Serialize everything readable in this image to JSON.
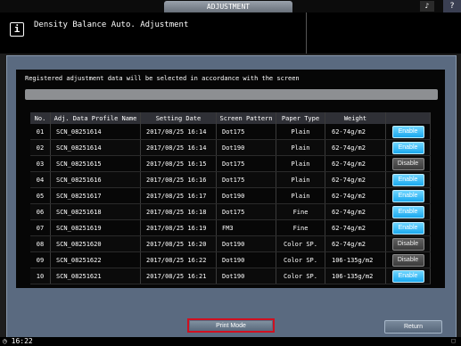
{
  "header": {
    "tab_label": "ADJUSTMENT",
    "sound_icon": "speaker-icon",
    "help_label": "?"
  },
  "message": {
    "icon_label": "i",
    "title": "Density Balance Auto. Adjustment"
  },
  "main": {
    "instruction": "Registered adjustment data will be selected in accordance with the screen",
    "columns": [
      "No.",
      "Adj. Data Profile Name",
      "Setting Date",
      "Screen Pattern",
      "Paper Type",
      "Weight",
      ""
    ],
    "rows": [
      {
        "no": "01",
        "name": "SCN_08251614",
        "date": "2017/08/25 16:14",
        "pattern": "Dot175",
        "paper": "Plain",
        "weight": "62-74g/m2",
        "status": "Enable",
        "state": "enable"
      },
      {
        "no": "02",
        "name": "SCN_08251614",
        "date": "2017/08/25 16:14",
        "pattern": "Dot190",
        "paper": "Plain",
        "weight": "62-74g/m2",
        "status": "Enable",
        "state": "enable"
      },
      {
        "no": "03",
        "name": "SCN_08251615",
        "date": "2017/08/25 16:15",
        "pattern": "Dot175",
        "paper": "Plain",
        "weight": "62-74g/m2",
        "status": "Disable",
        "state": "disable"
      },
      {
        "no": "04",
        "name": "SCN_08251616",
        "date": "2017/08/25 16:16",
        "pattern": "Dot175",
        "paper": "Plain",
        "weight": "62-74g/m2",
        "status": "Enable",
        "state": "enable"
      },
      {
        "no": "05",
        "name": "SCN_08251617",
        "date": "2017/08/25 16:17",
        "pattern": "Dot190",
        "paper": "Plain",
        "weight": "62-74g/m2",
        "status": "Enable",
        "state": "enable"
      },
      {
        "no": "06",
        "name": "SCN_08251618",
        "date": "2017/08/25 16:18",
        "pattern": "Dot175",
        "paper": "Fine",
        "weight": "62-74g/m2",
        "status": "Enable",
        "state": "enable"
      },
      {
        "no": "07",
        "name": "SCN_08251619",
        "date": "2017/08/25 16:19",
        "pattern": "FM3",
        "paper": "Fine",
        "weight": "62-74g/m2",
        "status": "Enable",
        "state": "enable"
      },
      {
        "no": "08",
        "name": "SCN_08251620",
        "date": "2017/08/25 16:20",
        "pattern": "Dot190",
        "paper": "Color SP.",
        "weight": "62-74g/m2",
        "status": "Disable",
        "state": "disable"
      },
      {
        "no": "09",
        "name": "SCN_08251622",
        "date": "2017/08/25 16:22",
        "pattern": "Dot190",
        "paper": "Color SP.",
        "weight": "106-135g/m2",
        "status": "Disable",
        "state": "disable"
      },
      {
        "no": "10",
        "name": "SCN_08251621",
        "date": "2017/08/25 16:21",
        "pattern": "Dot190",
        "paper": "Color SP.",
        "weight": "106-135g/m2",
        "status": "Enable",
        "state": "enable"
      }
    ]
  },
  "footer": {
    "print_mode_label": "Print Mode",
    "return_label": "Return",
    "time": "16:22"
  },
  "colors": {
    "accent_enable": "#1aa8ee",
    "highlight_border": "#cf1020",
    "panel": "#5a6a80"
  }
}
